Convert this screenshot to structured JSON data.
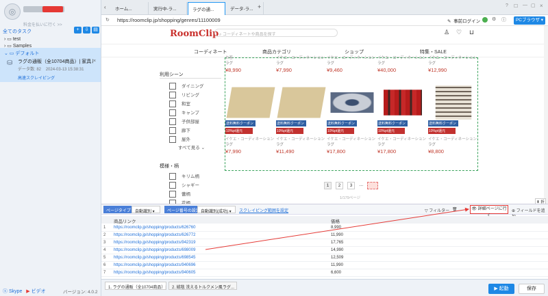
{
  "sidebar": {
    "account_sub": "料金を払いに行く >>",
    "tasks_header": "全てのタスク",
    "folders": [
      "test",
      "Samples",
      "デフォルト"
    ],
    "task_title": "ラグの通販（全10704商品）| 家具とインテ",
    "task_meta_label": "データ数:",
    "task_meta_count": "82",
    "task_meta_date": "2024-03-13 15:38:31",
    "task_tag": "高速スクレイピング",
    "footer_skype": "Skype",
    "footer_video": "ビデオ",
    "version": "バージョン: 4.0.2"
  },
  "browser": {
    "tabs": [
      "ホーム...",
      "実行中-ラ...",
      "ラグの通...",
      "データ-ラ..."
    ],
    "url": "https://roomclip.jp/shopping/genres/11100009",
    "login": "事前ログイン",
    "pc_button": "PCブラウザ"
  },
  "page": {
    "logo": "RoomClip",
    "search_placeholder": "コーディネートや商品を探す",
    "nav": [
      "コーディネート",
      "商品カテゴリ",
      "ショップ",
      "特集・SALE"
    ],
    "usage_title": "利用シーン",
    "usage": [
      "ダイニング",
      "リビング",
      "和室",
      "キャンプ",
      "子供部屋",
      "廊下",
      "屋外"
    ],
    "see_all": "すべて見る",
    "pattern_title": "模様・柄",
    "patterns": [
      "キリム柄",
      "シャギー",
      "蕾柄",
      "花柄"
    ],
    "top_row": [
      {
        "label": "お客",
        "cat": "ラグ",
        "price": "¥8,990"
      },
      {
        "label": "イケエ・コーディネーション",
        "cat": "ラグ",
        "price": "¥7,990"
      },
      {
        "label": "イケエ・コーディネーション",
        "cat": "ラグ",
        "price": "¥9,460"
      },
      {
        "label": "イケエ・コーディネーション",
        "cat": "ラグ",
        "price": "¥40,000"
      },
      {
        "label": "イケエ・コーディネーション",
        "cat": "ラグ",
        "price": "¥12,990"
      }
    ],
    "bottom_row": [
      {
        "badge": "送料無料クーポン",
        "badge2": "10%pt還元",
        "label": "イケエ・コーディネーション",
        "cat": "ラグ",
        "price": "¥7,990"
      },
      {
        "badge": "送料無料クーポン",
        "badge2": "10%pt還元",
        "label": "イケエ・コーディネーション",
        "cat": "ラグ",
        "price": "¥11,490"
      },
      {
        "badge": "送料無料クーポン",
        "badge2": "10%pt還元",
        "label": "イケエ・コーディネーション",
        "cat": "ラグ",
        "price": "¥17,800"
      },
      {
        "badge": "送料無料クーポン",
        "badge2": "10%pt還元",
        "label": "イケエ・コーディネーション",
        "cat": "ラグ",
        "price": "¥17,800"
      },
      {
        "badge": "送料無料クーポン",
        "badge2": "10%pt還元",
        "label": "イケエ・コーディネーション",
        "cat": "ラグ",
        "price": "¥8,800"
      }
    ],
    "pages": [
      "1",
      "2",
      "3",
      "..."
    ],
    "page_count": "1/179ページ"
  },
  "panel": {
    "page_type": "ページタイプ",
    "page_type_value": "自動識別",
    "pagination": "ページ番号の設定",
    "pagination_value": "自動識別(成功)",
    "scrape_range": "スクレイピング範囲を設定",
    "filter": "フィルター",
    "detail_button": "詳細ページに行く",
    "add_field": "フィールドを追加",
    "collapse": "折る",
    "col_link": "商品リンク",
    "col_price": "価格",
    "rows": [
      {
        "n": "1",
        "url": "https://roomclip.jp/shopping/products/626760",
        "price": "8,990"
      },
      {
        "n": "2",
        "url": "https://roomclip.jp/shopping/products/626772",
        "price": "11,990"
      },
      {
        "n": "3",
        "url": "https://roomclip.jp/shopping/products/942319",
        "price": "17,765"
      },
      {
        "n": "4",
        "url": "https://roomclip.jp/shopping/products/698009",
        "price": "14,990"
      },
      {
        "n": "5",
        "url": "https://roomclip.jp/shopping/products/698545",
        "price": "12,509"
      },
      {
        "n": "6",
        "url": "https://roomclip.jp/shopping/products/940696",
        "price": "11,990"
      },
      {
        "n": "7",
        "url": "https://roomclip.jp/shopping/products/940605",
        "price": "6,600"
      }
    ]
  },
  "bottom": {
    "tab1": "1. ラグの通販（全10704商品）|...",
    "tab2": "2. 絨毯 洗えるトルクメン風ラグ...",
    "run": "▶ 起動",
    "save": "保存"
  },
  "colors": {
    "accent": "#1e88e5",
    "highlight": "#e53935",
    "selected": "#cde4fb"
  }
}
